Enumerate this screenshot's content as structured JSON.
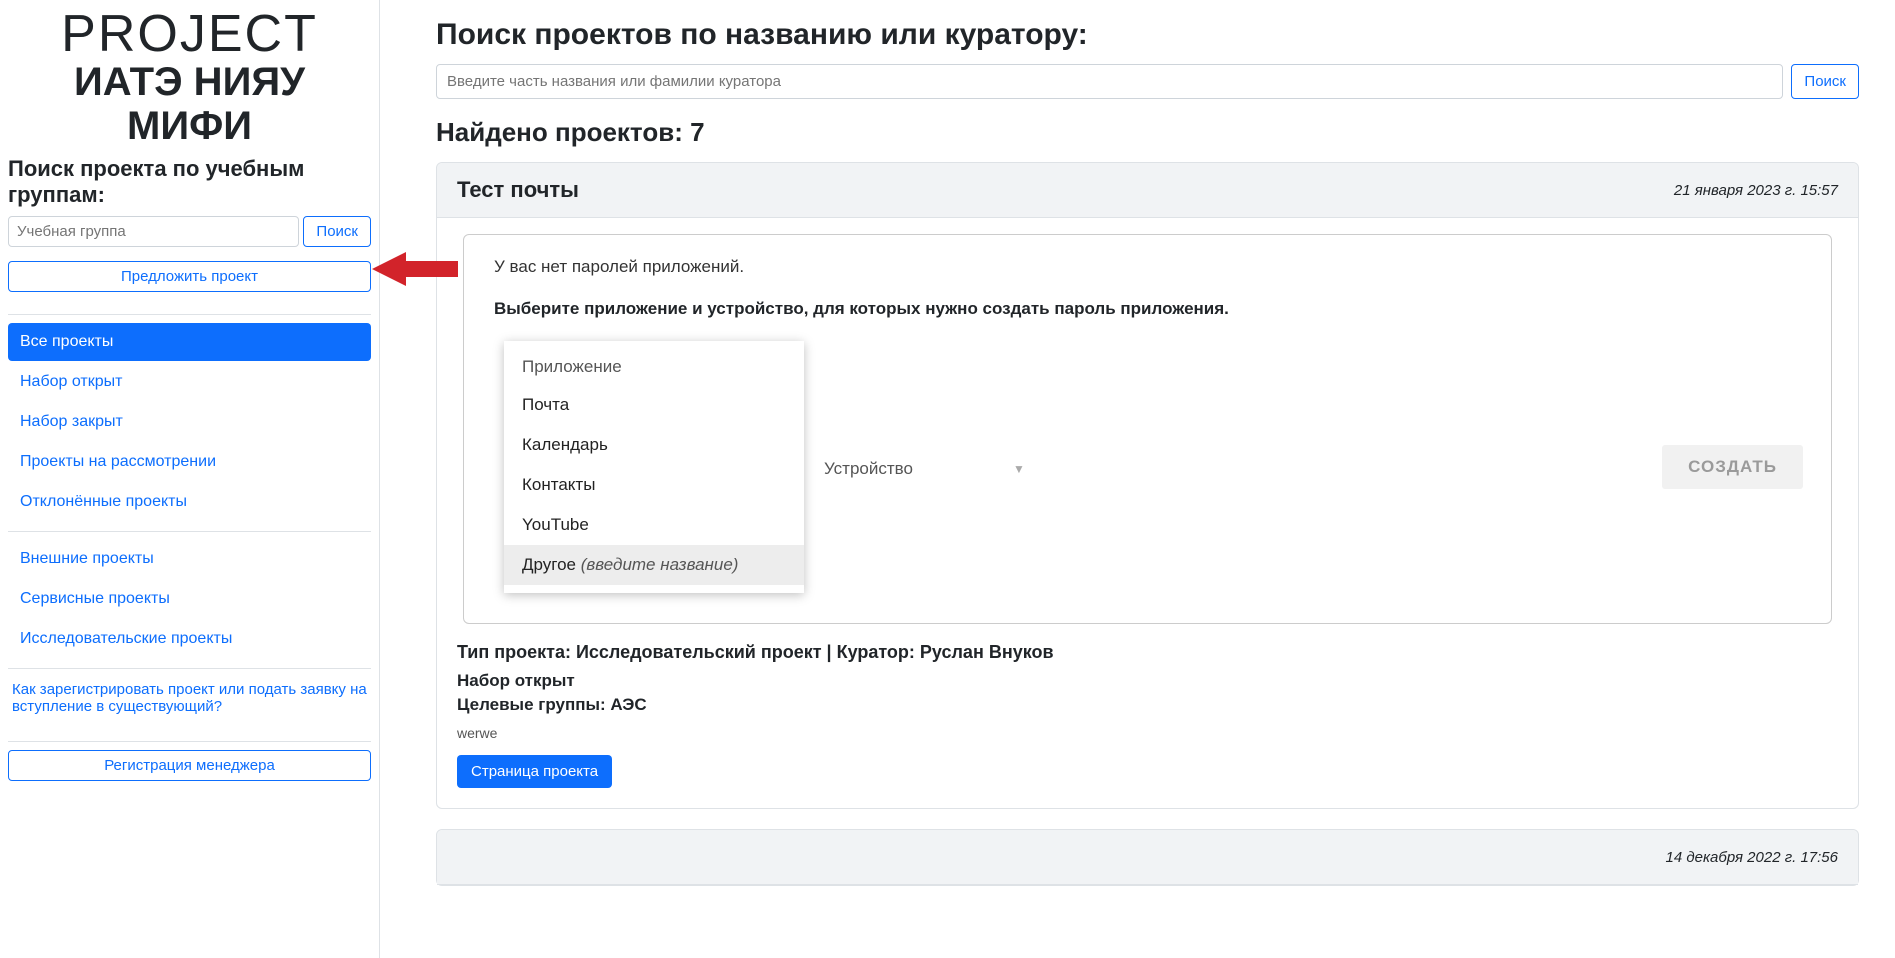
{
  "logo": {
    "line1": "PROJECT",
    "line2": "ИАТЭ НИЯУ МИФИ"
  },
  "sidebar": {
    "heading": "Поиск проекта по учебным группам:",
    "group_placeholder": "Учебная группа",
    "search_label": "Поиск",
    "propose_label": "Предложить проект",
    "nav1": [
      "Все проекты",
      "Набор открыт",
      "Набор закрыт",
      "Проекты на рассмотрении",
      "Отклонённые проекты"
    ],
    "nav2": [
      "Внешние проекты",
      "Сервисные проекты",
      "Исследовательские проекты"
    ],
    "help_text": "Как зарегистрировать проект или подать заявку на вступление в существующий?",
    "register_label": "Регистрация менеджера"
  },
  "main": {
    "heading": "Поиск проектов по названию или куратору:",
    "search_placeholder": "Введите часть названия или фамилии куратора",
    "search_button": "Поиск",
    "found_label": "Найдено проектов: 7"
  },
  "card1": {
    "title": "Тест почты",
    "date": "21 января 2023 г. 15:57",
    "screenshot": {
      "no_passwords": "У вас нет паролей приложений.",
      "instruction": "Выберите приложение и устройство, для которых нужно создать пароль приложения.",
      "app_label": "Приложение",
      "options": [
        "Почта",
        "Календарь",
        "Контакты",
        "YouTube"
      ],
      "other_label": "Другое",
      "other_hint": "(введите название)",
      "device_label": "Устройство",
      "create_label": "СОЗДАТЬ"
    },
    "meta": "Тип проекта: Исследовательский проект | Куратор: Руслан Внуков",
    "status": "Набор открыт",
    "groups": "Целевые группы: АЭС",
    "desc": "werwe",
    "page_button": "Страница проекта"
  },
  "card2": {
    "date": "14 декабря 2022 г. 17:56"
  }
}
